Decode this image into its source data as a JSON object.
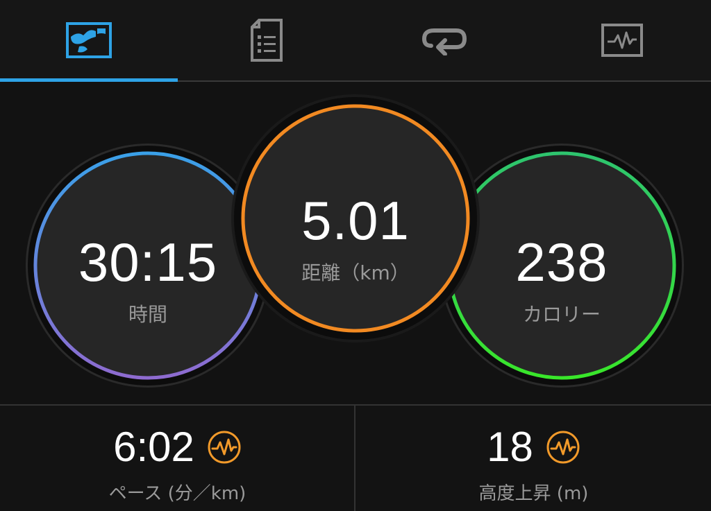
{
  "tabs": [
    {
      "id": "map",
      "icon": "map-icon",
      "active": true
    },
    {
      "id": "details",
      "icon": "document-list-icon",
      "active": false
    },
    {
      "id": "laps",
      "icon": "repeat-icon",
      "active": false
    },
    {
      "id": "charts",
      "icon": "chart-icon",
      "active": false
    }
  ],
  "colors": {
    "accent": "#2ea3e6",
    "time_ring_start": "#3aa0e8",
    "time_ring_end": "#8e6bd0",
    "distance_ring": "#f28a22",
    "calorie_ring_start": "#2ec46e",
    "calorie_ring_end": "#39e62a",
    "badge": "#f29a2a"
  },
  "rings": {
    "time": {
      "value": "30:15",
      "label": "時間"
    },
    "distance": {
      "value": "5.01",
      "label": "距離（km）"
    },
    "calories": {
      "value": "238",
      "label": "カロリー"
    }
  },
  "stats": {
    "pace": {
      "value": "6:02",
      "label": "ペース (分／km)",
      "icon": "activity-pulse-icon"
    },
    "elevation": {
      "value": "18",
      "label": "高度上昇 (m)",
      "icon": "activity-pulse-icon"
    }
  }
}
